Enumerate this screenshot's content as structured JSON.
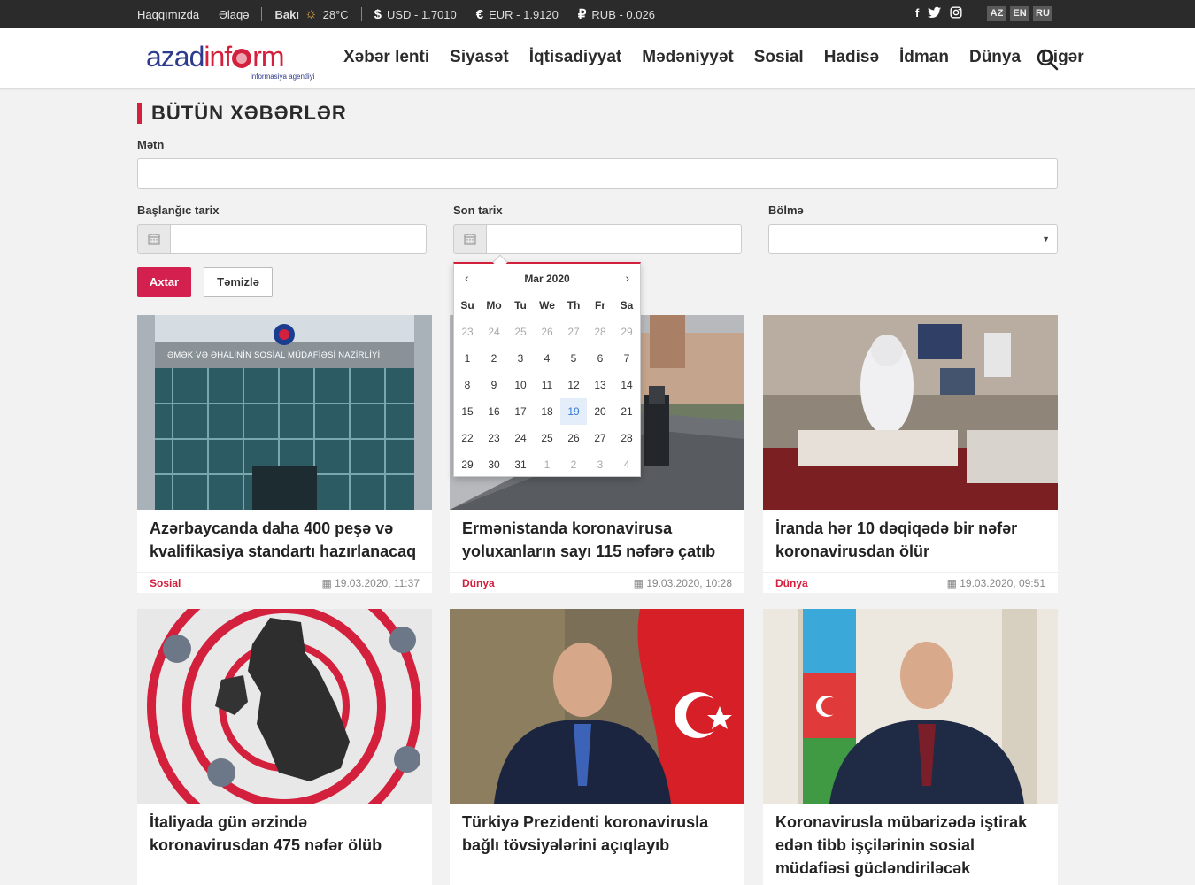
{
  "topbar": {
    "links": [
      "Haqqımızda",
      "Əlaqə"
    ],
    "city": "Bakı",
    "temperature": "28°C",
    "currencies": [
      {
        "icon": "$",
        "label": "USD - 1.7010"
      },
      {
        "icon": "€",
        "label": "EUR - 1.9120"
      },
      {
        "icon": "₽",
        "label": "RUB - 0.026"
      }
    ],
    "social": [
      "facebook-icon",
      "twitter-icon",
      "instagram-icon"
    ],
    "languages": [
      "AZ",
      "EN",
      "RU"
    ]
  },
  "header": {
    "logo_part1": "azad",
    "logo_part2a": "inf",
    "logo_part2b": "rm",
    "logo_tagline": "informasiya agentliyi",
    "nav": [
      "Xəbər lenti",
      "Siyasət",
      "İqtisadiyyat",
      "Mədəniyyət",
      "Sosial",
      "Hadisə",
      "İdman",
      "Dünya",
      "Digər"
    ]
  },
  "search": {
    "title": "BÜTÜN XƏBƏRLƏR",
    "text_label": "Mətn",
    "text_value": "",
    "start_label": "Başlanğıc tarix",
    "start_value": "",
    "end_label": "Son tarix",
    "end_value": "",
    "section_label": "Bölmə",
    "section_value": "",
    "submit_label": "Axtar",
    "clear_label": "Təmizlə"
  },
  "calendar": {
    "month": "Mar 2020",
    "prev": "‹",
    "next": "›",
    "weekdays": [
      "Su",
      "Mo",
      "Tu",
      "We",
      "Th",
      "Fr",
      "Sa"
    ],
    "weeks": [
      [
        "23",
        "24",
        "25",
        "26",
        "27",
        "28",
        "29"
      ],
      [
        "1",
        "2",
        "3",
        "4",
        "5",
        "6",
        "7"
      ],
      [
        "8",
        "9",
        "10",
        "11",
        "12",
        "13",
        "14"
      ],
      [
        "15",
        "16",
        "17",
        "18",
        "19",
        "20",
        "21"
      ],
      [
        "22",
        "23",
        "24",
        "25",
        "26",
        "27",
        "28"
      ],
      [
        "29",
        "30",
        "31",
        "1",
        "2",
        "3",
        "4"
      ]
    ],
    "today": "19"
  },
  "news": [
    {
      "title": "Azərbaycanda daha 400 peşə və kvalifikasiya standartı hazırlanacaq",
      "category": "Sosial",
      "date": "19.03.2020, 11:37",
      "image_sign": "ƏMƏK VƏ ƏHALİNİN SOSİAL MÜDAFİƏSİ NAZİRLİYİ"
    },
    {
      "title": "Ermənistanda koronavirusa yoluxanların sayı 115 nəfərə çatıb",
      "category": "Dünya",
      "date": "19.03.2020, 10:28"
    },
    {
      "title": "İranda hər 10 dəqiqədə bir nəfər koronavirusdan ölür",
      "category": "Dünya",
      "date": "19.03.2020, 09:51"
    },
    {
      "title": "İtaliyada gün ərzində koronavirusdan 475 nəfər ölüb"
    },
    {
      "title": "Türkiyə Prezidenti koronavirusla bağlı tövsiyələrini açıqlayıb"
    },
    {
      "title": "Koronavirusla mübarizədə iştirak edən tibb işçilərinin sosial müdafiəsi gücləndiriləcək"
    }
  ],
  "colors": {
    "accent": "#d3203d",
    "topbar": "#2b2b2b",
    "logo_blue": "#2e3a8c"
  }
}
